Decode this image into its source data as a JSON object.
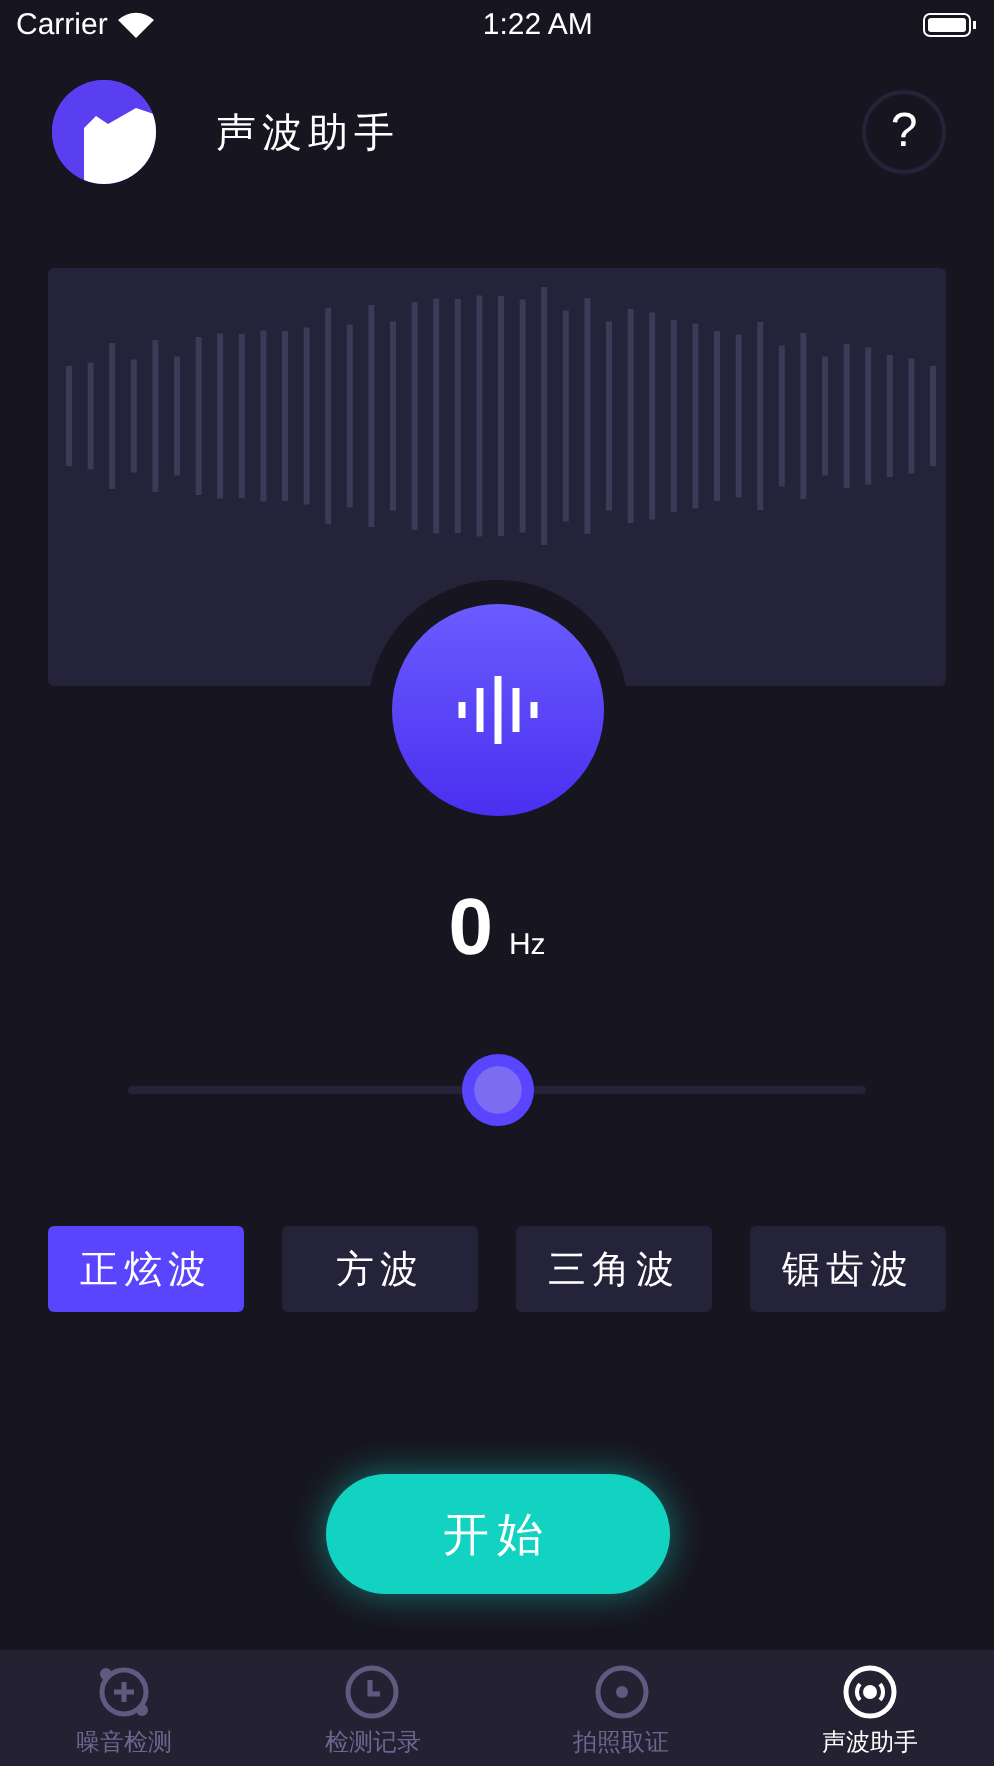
{
  "status_bar": {
    "carrier": "Carrier",
    "time": "1:22 AM"
  },
  "header": {
    "title": "声波助手",
    "help": "?"
  },
  "frequency": {
    "value": "0",
    "unit": "Hz"
  },
  "slider": {
    "level": 0.5
  },
  "wave_types": [
    {
      "label": "正炫波",
      "selected": true
    },
    {
      "label": "方波",
      "selected": false
    },
    {
      "label": "三角波",
      "selected": false
    },
    {
      "label": "锯齿波",
      "selected": false
    }
  ],
  "start_button": "开始",
  "tab_bar": [
    {
      "label": "噪音检测",
      "kind": "plus",
      "selected": false
    },
    {
      "label": "检测记录",
      "kind": "clock",
      "selected": false
    },
    {
      "label": "拍照取证",
      "kind": "camera",
      "selected": false
    },
    {
      "label": "声波助手",
      "kind": "wave",
      "selected": true
    }
  ]
}
